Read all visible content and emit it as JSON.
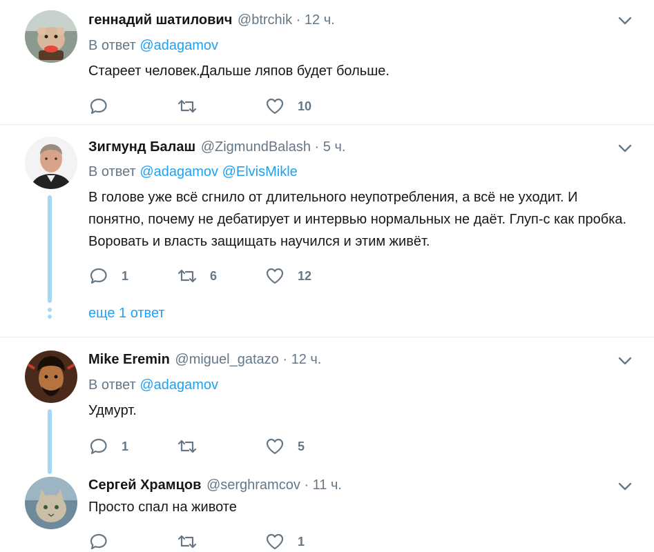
{
  "tweets": [
    {
      "name": "геннадий шатилович",
      "handle": "@btrchik",
      "sep": "·",
      "time": "12 ч.",
      "reply_label": "В ответ",
      "mentions": [
        "@adagamov"
      ],
      "text": "Стареет человек.Дальше ляпов будет больше.",
      "replies": "",
      "retweets": "",
      "likes": "10"
    },
    {
      "name": "Зигмунд Балаш",
      "handle": "@ZigmundBalash",
      "sep": "·",
      "time": "5 ч.",
      "reply_label": "В ответ",
      "mentions": [
        "@adagamov",
        "@ElvisMikle"
      ],
      "text": "В голове уже всё сгнило от длительного неупотребления, а всё не уходит. И понятно, почему не дебатирует и интервью нормальных не даёт. Глуп-с как пробка. Воровать и власть защищать научился и этим живёт.",
      "replies": "1",
      "retweets": "6",
      "likes": "12",
      "more_replies": "еще 1 ответ"
    },
    {
      "name": "Mike Eremin",
      "handle": "@miguel_gatazo",
      "sep": "·",
      "time": "12 ч.",
      "reply_label": "В ответ",
      "mentions": [
        "@adagamov"
      ],
      "text": "Удмурт.",
      "replies": "1",
      "retweets": "",
      "likes": "5"
    },
    {
      "name": "Сергей Храмцов",
      "handle": "@serghramcov",
      "sep": "·",
      "time": "11 ч.",
      "text": "Просто спал на животе",
      "replies": "",
      "retweets": "",
      "likes": "1"
    }
  ],
  "icons": {
    "reply": "reply-icon",
    "retweet": "retweet-icon",
    "like": "heart-icon",
    "menu": "chevron-down-icon"
  },
  "colors": {
    "link": "#1da1f2",
    "secondary": "#657786",
    "text": "#14171a",
    "thread": "#a5d7f7"
  }
}
